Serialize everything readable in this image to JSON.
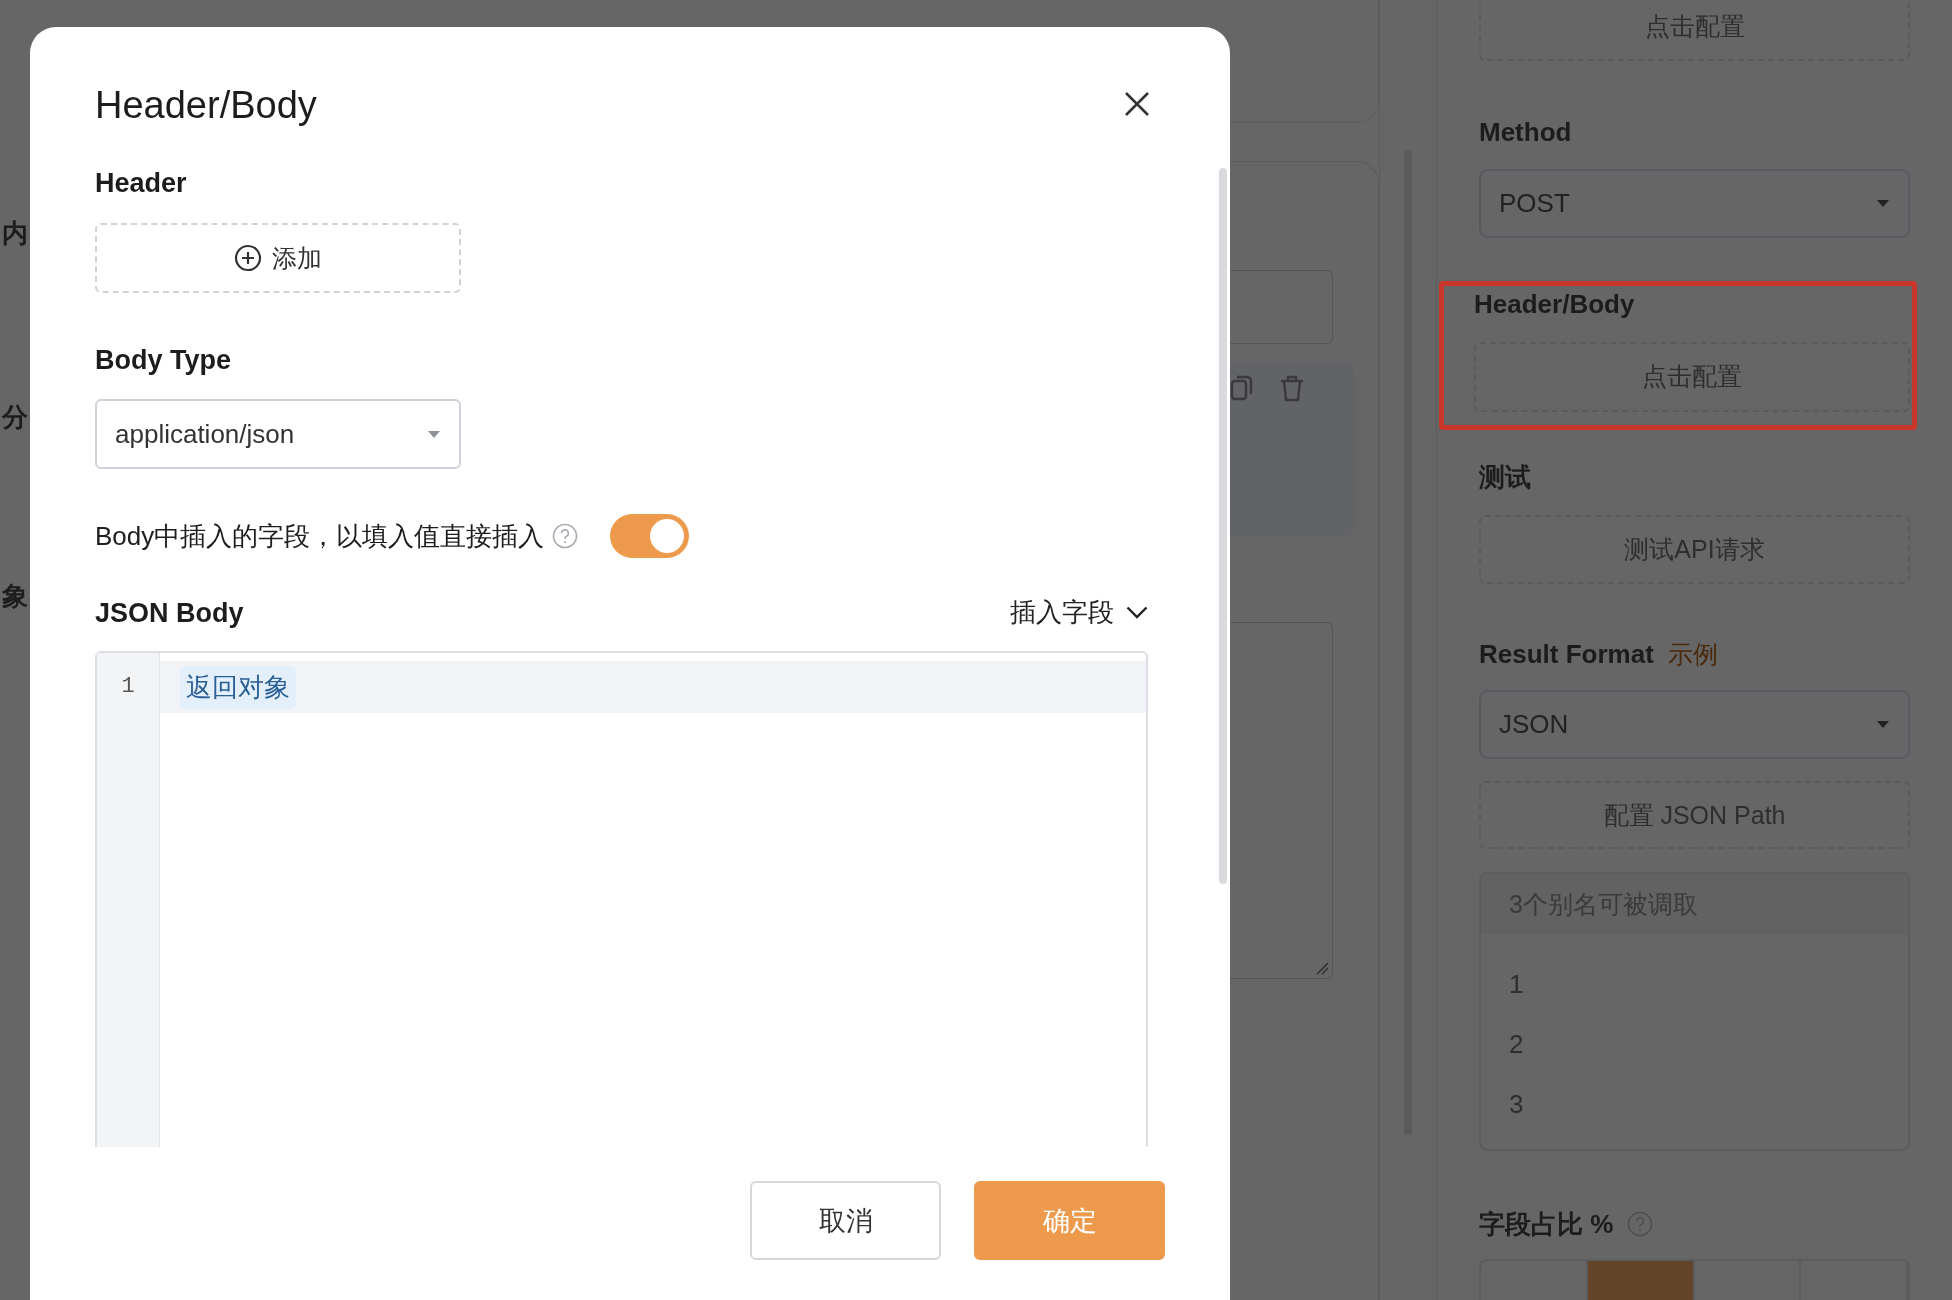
{
  "background": {
    "left_fragments": [
      "内",
      "分",
      "象"
    ]
  },
  "modal": {
    "title": "Header/Body",
    "header_label": "Header",
    "add_button": "添加",
    "body_type_label": "Body Type",
    "body_type_select": {
      "value": "application/json"
    },
    "toggle": {
      "label": "Body中插入的字段，以填入值直接插入",
      "on": true
    },
    "json_body_label": "JSON Body",
    "insert_field": "插入字段",
    "editor": {
      "lines": [
        {
          "number": "1",
          "tokens": [
            "返回对象"
          ]
        }
      ]
    },
    "buttons": [
      {
        "label": "取消",
        "kind": "secondary"
      },
      {
        "label": "确定",
        "kind": "primary"
      }
    ]
  },
  "side_panel": {
    "top_button": "点击配置",
    "method": {
      "label": "Method",
      "value": "POST"
    },
    "header_body": {
      "label": "Header/Body",
      "button": "点击配置",
      "highlighted": true
    },
    "test": {
      "label": "测试",
      "button": "测试API请求"
    },
    "result_format": {
      "label": "Result Format",
      "example_link": "示例",
      "value": "JSON",
      "json_path_button": "配置 JSON Path",
      "aliases": {
        "title": "3个别名可被调取",
        "items": [
          "1",
          "2",
          "3"
        ]
      }
    },
    "ratio": {
      "label": "字段占比 %",
      "segments": [
        {
          "selected": false
        },
        {
          "selected": true
        },
        {
          "selected": false
        },
        {
          "selected": false
        }
      ]
    }
  }
}
